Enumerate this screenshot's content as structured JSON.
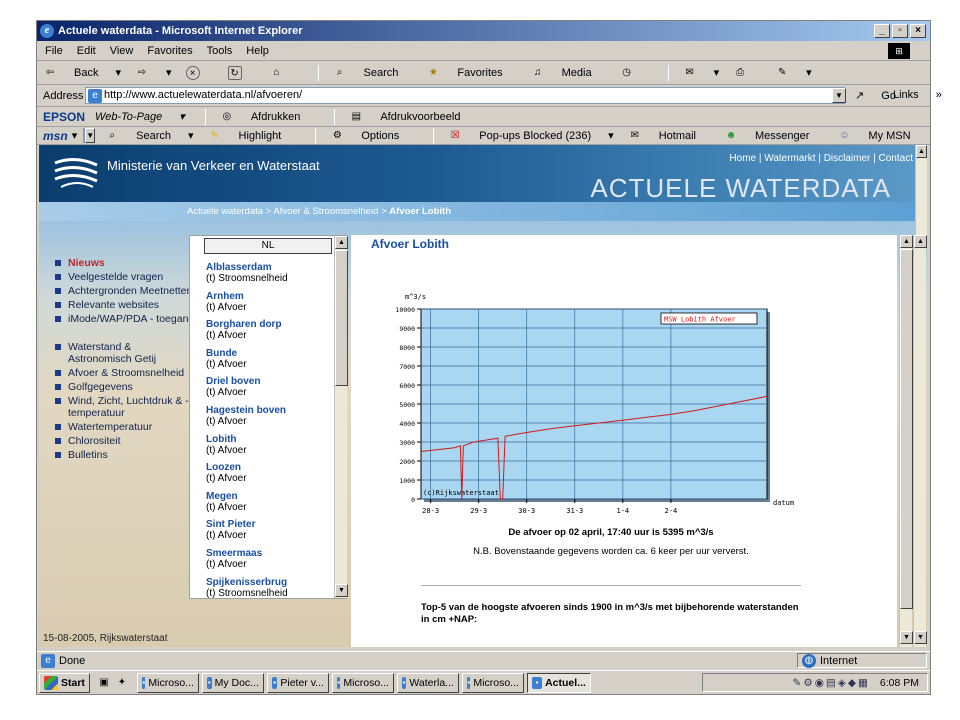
{
  "window": {
    "title": "Actuele waterdata - Microsoft Internet Explorer",
    "ie_glyph": "e"
  },
  "menu": [
    "File",
    "Edit",
    "View",
    "Favorites",
    "Tools",
    "Help"
  ],
  "toolbar": {
    "back": "Back",
    "search": "Search",
    "favorites": "Favorites",
    "media": "Media"
  },
  "address": {
    "label": "Address",
    "url": "http://www.actuelewaterdata.nl/afvoeren/",
    "go": "Go",
    "links": "Links"
  },
  "epson_bar": {
    "brand": "EPSON",
    "web_to_page": "Web-To-Page",
    "print": "Afdrukken",
    "preview": "Afdrukvoorbeeld"
  },
  "msn_bar": {
    "brand": "msn",
    "search": "Search",
    "highlight": "Highlight",
    "options": "Options",
    "popups": "Pop-ups Blocked (236)",
    "hotmail": "Hotmail",
    "messenger": "Messenger",
    "mymsn": "My MSN"
  },
  "site": {
    "ministry": "Ministerie van Verkeer en Waterstaat",
    "toplinks": "Home | Watermarkt | Disclaimer | Contact",
    "big_title": "ACTUELE WATERDATA",
    "breadcrumb": "Actuele waterdata > Afvoer & Stroomsnelheid > ",
    "breadcrumb_current": "Afvoer Lobith",
    "nav": [
      {
        "label": "Nieuws",
        "active": true
      },
      {
        "label": "Veelgestelde vragen",
        "active": false
      },
      {
        "label": "Achtergronden Meetnetten",
        "active": false
      },
      {
        "label": "Relevante websites",
        "active": false
      },
      {
        "label": "iMode/WAP/PDA - toegang",
        "active": false
      },
      {
        "label": "Waterstand & Astronomisch Getij",
        "active": false
      },
      {
        "label": "Afvoer & Stroomsnelheid",
        "active": false
      },
      {
        "label": "Golfgegevens",
        "active": false
      },
      {
        "label": "Wind, Zicht, Luchtdruk & -temperatuur",
        "active": false
      },
      {
        "label": "Watertemperatuur",
        "active": false
      },
      {
        "label": "Chlorositeit",
        "active": false
      },
      {
        "label": "Bulletins",
        "active": false
      }
    ],
    "footer": "15-08-2005, Rijkswaterstaat",
    "list_header": "NL",
    "rivers": [
      {
        "name": "Alblasserdam",
        "type": "(t) Stroomsnelheid"
      },
      {
        "name": "Arnhem",
        "type": "(t) Afvoer"
      },
      {
        "name": "Borgharen dorp",
        "type": "(t) Afvoer"
      },
      {
        "name": "Bunde",
        "type": "(t) Afvoer"
      },
      {
        "name": "Driel boven",
        "type": "(t) Afvoer"
      },
      {
        "name": "Hagestein boven",
        "type": "(t) Afvoer"
      },
      {
        "name": "Lobith",
        "type": "(t) Afvoer"
      },
      {
        "name": "Loozen",
        "type": "(t) Afvoer"
      },
      {
        "name": "Megen",
        "type": "(t) Afvoer"
      },
      {
        "name": "Sint Pieter",
        "type": "(t) Afvoer"
      },
      {
        "name": "Smeermaas",
        "type": "(t) Afvoer"
      },
      {
        "name": "Spijkenisserbrug",
        "type": "(t) Stroomsnelheid"
      }
    ],
    "page_title": "Afvoer Lobith",
    "caption_bold": "De afvoer op 02 april, 17:40 uur is 5395 m^3/s",
    "caption_note": "N.B. Bovenstaande gegevens worden ca. 6 keer per uur ververst.",
    "top5": "Top-5 van de hoogste afvoeren sinds 1900 in m^3/s met bijbehorende waterstanden in cm +NAP:"
  },
  "chart_data": {
    "type": "line",
    "title": "",
    "ylabel": "m^3/s",
    "xlabel": "datum",
    "ylim": [
      0,
      10000
    ],
    "xlim": [
      27.8,
      35.0
    ],
    "yticks": [
      0,
      1000,
      2000,
      3000,
      4000,
      5000,
      6000,
      7000,
      8000,
      9000,
      10000
    ],
    "xticks": [
      {
        "pos": 28,
        "label": "28-3"
      },
      {
        "pos": 29,
        "label": "29-3"
      },
      {
        "pos": 30,
        "label": "30-3"
      },
      {
        "pos": 31,
        "label": "31-3"
      },
      {
        "pos": 32,
        "label": "1-4"
      },
      {
        "pos": 33,
        "label": "2-4"
      }
    ],
    "grid": true,
    "legend": "top-right",
    "copyright": "(c)Rijkswaterstaat",
    "colors": {
      "plot_bg": "#a9d6f0",
      "line": "#d11a1a",
      "grid": "#3a6d9a"
    },
    "series": [
      {
        "name": "MSW Lobith Afvoer",
        "x": [
          27.8,
          28.5,
          28.62,
          28.65,
          28.68,
          28.9,
          29.4,
          29.45,
          29.5,
          29.55,
          30.0,
          30.5,
          31.0,
          31.5,
          32.0,
          32.5,
          33.0,
          33.5,
          34.0,
          34.5,
          35.0
        ],
        "y": [
          2500,
          2700,
          2800,
          0,
          2800,
          3000,
          3200,
          0,
          0,
          3300,
          3500,
          3700,
          3850,
          4000,
          4150,
          4300,
          4450,
          4650,
          4900,
          5150,
          5400
        ]
      }
    ]
  },
  "status": {
    "done": "Done",
    "zone": "Internet"
  },
  "taskbar": {
    "start": "Start",
    "tasks": [
      "Microso...",
      "My Doc...",
      "Pieter v...",
      "Microso...",
      "Waterla...",
      "Microso...",
      "Actuel..."
    ],
    "active_index": 6,
    "clock": "6:08 PM"
  }
}
